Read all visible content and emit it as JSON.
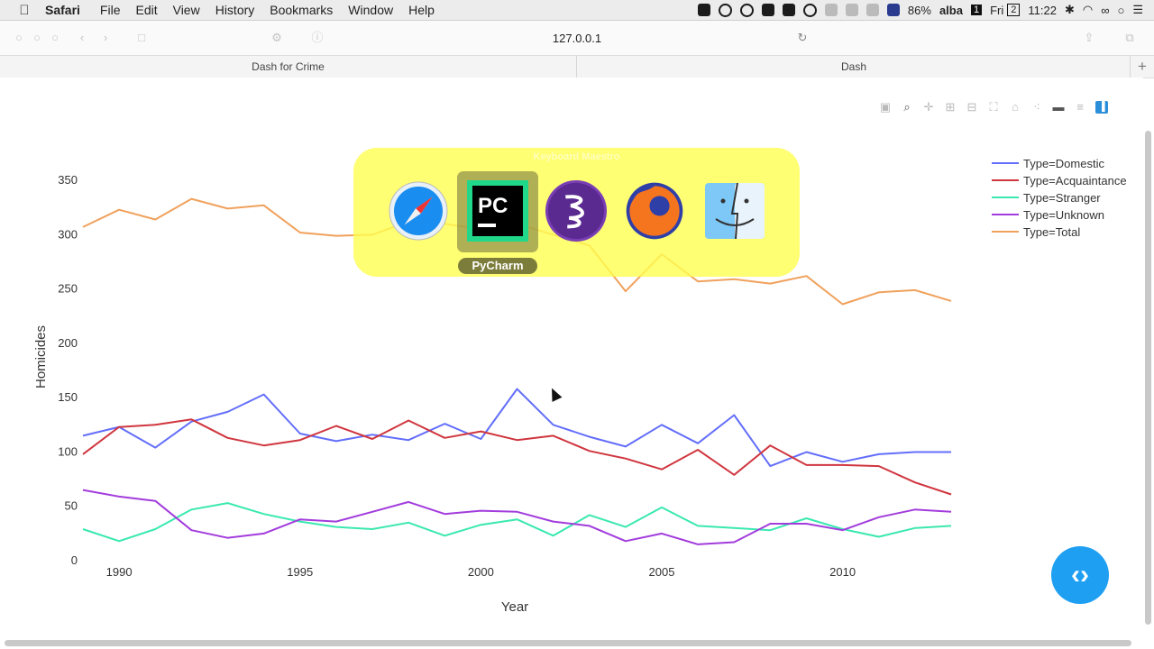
{
  "menubar": {
    "app_name": "Safari",
    "menus": [
      "File",
      "Edit",
      "View",
      "History",
      "Bookmarks",
      "Window",
      "Help"
    ],
    "status": {
      "battery": "86%",
      "user": "alba",
      "space_badge": "1",
      "day": "Fri",
      "day_badge": "2",
      "time": "11:22"
    }
  },
  "toolbar": {
    "url": "127.0.0.1"
  },
  "tabs": [
    {
      "label": "Dash for Crime"
    },
    {
      "label": "Dash"
    }
  ],
  "switcher": {
    "title": "Keyboard Maestro",
    "selected_label": "PyCharm",
    "apps": [
      "safari-icon",
      "pycharm-icon",
      "emacs-icon",
      "firefox-icon",
      "finder-icon"
    ]
  },
  "colors": {
    "domestic": "#636efa",
    "acquaintance": "#d0363f",
    "stranger": "#3ae8b0",
    "unknown": "#a23cdc",
    "total": "#f0a15c",
    "fab": "#1e9ff2"
  },
  "chart_data": {
    "type": "line",
    "xlabel": "Year",
    "ylabel": "Homicides",
    "xlim": [
      1988.9,
      2013
    ],
    "ylim": [
      0,
      370
    ],
    "x_ticks": [
      1990,
      1995,
      2000,
      2005,
      2010
    ],
    "y_ticks": [
      0,
      50,
      100,
      150,
      200,
      250,
      300,
      350
    ],
    "legend_position": "top-right",
    "x": [
      1989,
      1990,
      1991,
      1992,
      1993,
      1994,
      1995,
      1996,
      1997,
      1998,
      1999,
      2000,
      2001,
      2002,
      2003,
      2004,
      2005,
      2006,
      2007,
      2008,
      2009,
      2010,
      2011,
      2012,
      2013
    ],
    "series": [
      {
        "name": "Type=Domestic",
        "values": [
          115,
          123,
          104,
          128,
          137,
          153,
          117,
          110,
          116,
          111,
          126,
          112,
          158,
          125,
          114,
          105,
          125,
          108,
          134,
          87,
          100,
          91,
          98,
          100,
          100
        ]
      },
      {
        "name": "Type=Acquaintance",
        "values": [
          98,
          123,
          125,
          130,
          113,
          106,
          111,
          124,
          112,
          129,
          113,
          119,
          111,
          115,
          101,
          94,
          84,
          102,
          79,
          106,
          88,
          88,
          87,
          72,
          61
        ]
      },
      {
        "name": "Type=Stranger",
        "values": [
          29,
          18,
          29,
          47,
          53,
          43,
          36,
          31,
          29,
          35,
          23,
          33,
          38,
          23,
          42,
          31,
          49,
          32,
          30,
          28,
          39,
          29,
          22,
          30,
          32
        ]
      },
      {
        "name": "Type=Unknown",
        "values": [
          65,
          59,
          55,
          28,
          21,
          25,
          38,
          36,
          45,
          54,
          43,
          46,
          45,
          36,
          32,
          18,
          25,
          15,
          17,
          34,
          34,
          28,
          40,
          47,
          45
        ]
      },
      {
        "name": "Type=Total",
        "values": [
          307,
          323,
          314,
          333,
          324,
          327,
          302,
          299,
          300,
          312,
          310,
          305,
          310,
          300,
          290,
          248,
          282,
          257,
          259,
          255,
          262,
          236,
          247,
          249,
          239
        ]
      }
    ]
  }
}
